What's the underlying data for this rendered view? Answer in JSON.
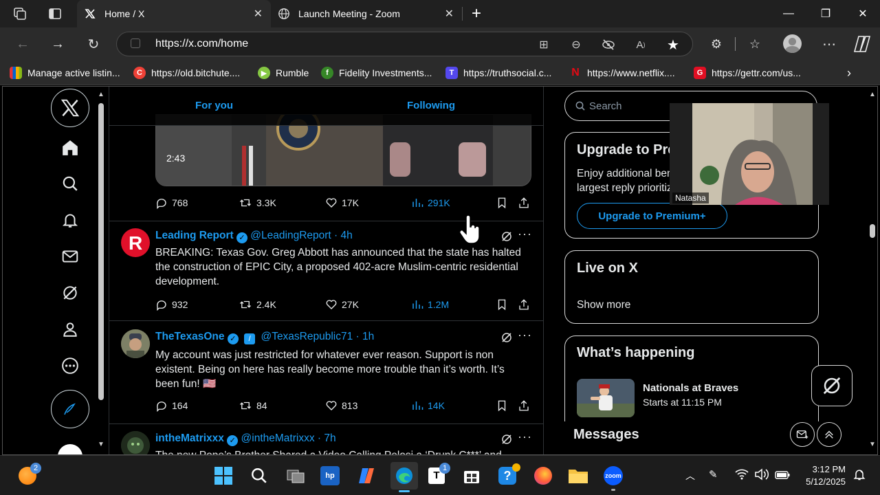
{
  "browser": {
    "tabs": [
      {
        "title": "Home / X",
        "active": true,
        "favicon": "x-logo-icon"
      },
      {
        "title": "Launch Meeting - Zoom",
        "active": false,
        "favicon": "globe-icon"
      }
    ],
    "url": "https://x.com/home",
    "bookmarks": [
      {
        "label": "Manage active listin...",
        "icon": "ebay-icon",
        "color": "#e53238"
      },
      {
        "label": "https://old.bitchute....",
        "icon": "bitchute-icon",
        "color": "#ef4137"
      },
      {
        "label": "Rumble",
        "icon": "rumble-icon",
        "color": "#85c742"
      },
      {
        "label": "Fidelity Investments...",
        "icon": "fidelity-icon",
        "color": "#368727"
      },
      {
        "label": "https://truthsocial.c...",
        "icon": "truthsocial-icon",
        "color": "#5448ee"
      },
      {
        "label": "https://www.netflix....",
        "icon": "netflix-icon",
        "color": "#e50914"
      },
      {
        "label": "https://gettr.com/us...",
        "icon": "gettr-icon",
        "color": "#e10f23"
      }
    ]
  },
  "x": {
    "tabs": {
      "for_you": "For you",
      "following": "Following"
    },
    "video_duration": "2:43",
    "video_actions": {
      "replies": "768",
      "reposts": "3.3K",
      "likes": "17K",
      "views": "291K"
    },
    "posts": [
      {
        "name": "Leading Report",
        "handle": "@LeadingReport",
        "time": "4h",
        "text": "BREAKING: Texas Gov. Greg Abbott has announced that the state has halted the construction of EPIC City, a proposed 402-acre Muslim-centric residential development.",
        "replies": "932",
        "reposts": "2.4K",
        "likes": "27K",
        "views": "1.2M"
      },
      {
        "name": "TheTexasOne",
        "handle": "@TexasRepublic71",
        "time": "1h",
        "text": "My account was just restricted for whatever ever reason. Support is non existent. Being on here has really become more trouble than it’s worth. It’s been fun! 🇺🇸",
        "replies": "164",
        "reposts": "84",
        "likes": "813",
        "views": "14K"
      },
      {
        "name": "intheMatrixxx",
        "handle": "@intheMatrixxx",
        "time": "7h",
        "text": "The new Pope’s Brother Shared a Video Calling Pelosi a ‘Drunk C***’ and"
      }
    ],
    "search_placeholder": "Search",
    "premium": {
      "title": "Upgrade to Premium+",
      "text": "Enjoy additional benefits, zero ads and the largest reply prioritization.",
      "button": "Upgrade to Premium+"
    },
    "live": {
      "title": "Live on X",
      "show_more": "Show more"
    },
    "happening": {
      "title": "What’s happening",
      "event_title": "Nationals at Braves",
      "event_sub": "Starts at 11:15 PM"
    },
    "messages": "Messages"
  },
  "zoom_overlay": {
    "name": "Natasha"
  },
  "taskbar": {
    "time": "3:12 PM",
    "date": "5/12/2025",
    "badge_left": "2",
    "badge_teams": "1"
  },
  "colors": {
    "accent": "#1d9bf0",
    "bg": "#000000",
    "chrome": "#2b2b2b"
  }
}
